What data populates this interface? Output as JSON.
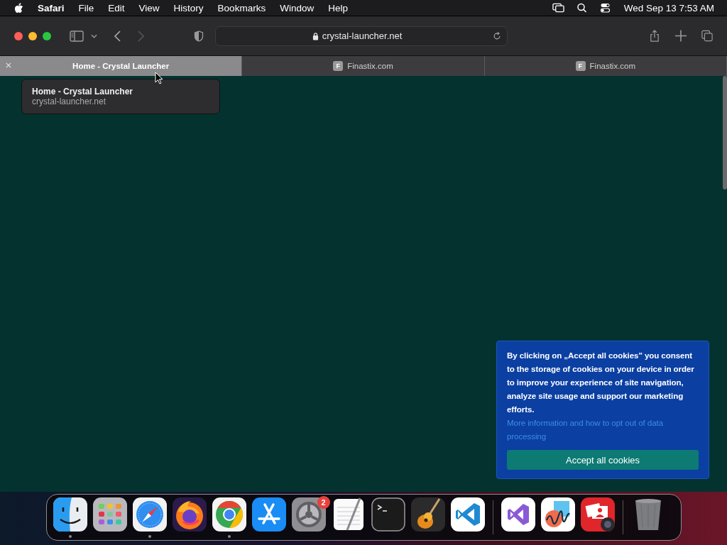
{
  "menubar": {
    "items": [
      {
        "label": "Safari",
        "kind": "app"
      },
      {
        "label": "File",
        "kind": "menu"
      },
      {
        "label": "Edit",
        "kind": "menu"
      },
      {
        "label": "View",
        "kind": "menu"
      },
      {
        "label": "History",
        "kind": "menu"
      },
      {
        "label": "Bookmarks",
        "kind": "menu"
      },
      {
        "label": "Window",
        "kind": "menu"
      },
      {
        "label": "Help",
        "kind": "menu"
      }
    ],
    "clock": "Wed Sep 13  7:53 AM"
  },
  "toolbar": {
    "address": "crystal-launcher.net",
    "back": {
      "disabled": false
    },
    "forward": {
      "disabled": true
    }
  },
  "tabs": [
    {
      "label": "Home - Crystal Launcher",
      "selected": true
    },
    {
      "label": "Finastix.com",
      "favicon": "F",
      "selected": false
    },
    {
      "label": "Finastix.com",
      "favicon": "F",
      "selected": false
    }
  ],
  "tab_tooltip": {
    "title": "Home - Crystal Launcher",
    "url": "crystal-launcher.net"
  },
  "cookie_banner": {
    "text": "By clicking on „Accept all cookies\" you consent to the storage of cookies on your device in order to improve your experience of site navigation, analyze site usage and support our marketing efforts.",
    "link": "More information and how to opt out of data processing",
    "button": "Accept all cookies"
  },
  "dock": [
    {
      "kind": "finder",
      "running": true
    },
    {
      "kind": "launchpad",
      "running": false
    },
    {
      "kind": "safari",
      "running": true
    },
    {
      "kind": "firefox",
      "running": false
    },
    {
      "kind": "chrome",
      "running": true
    },
    {
      "kind": "appstore",
      "running": false
    },
    {
      "kind": "settings",
      "running": false,
      "badge": "2"
    },
    {
      "kind": "textedit",
      "running": false
    },
    {
      "kind": "terminal",
      "running": false
    },
    {
      "kind": "garageband",
      "running": false
    },
    {
      "kind": "vscode",
      "running": false
    },
    {
      "kind": "separator"
    },
    {
      "kind": "visualstudio",
      "running": false
    },
    {
      "kind": "freeform",
      "running": false
    },
    {
      "kind": "photobooth",
      "running": false
    },
    {
      "kind": "separator"
    },
    {
      "kind": "trash",
      "running": false
    }
  ]
}
